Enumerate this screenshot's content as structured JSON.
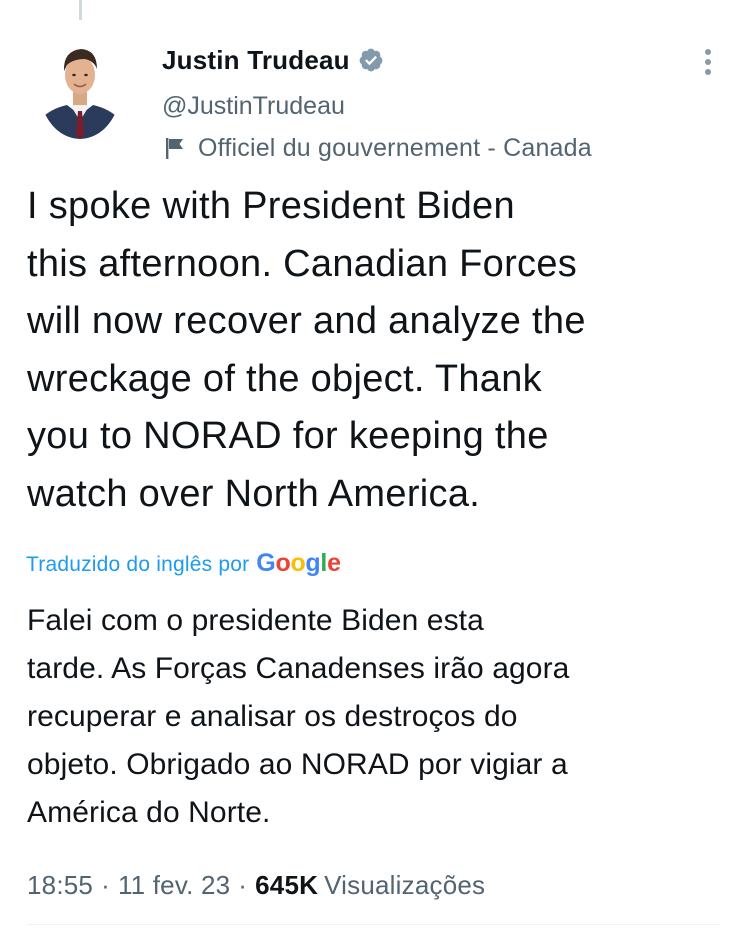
{
  "tweet": {
    "author": {
      "display_name": "Justin Trudeau",
      "handle": "@JustinTrudeau",
      "verified": true,
      "label": "Officiel du gouvernement - Canada"
    },
    "text_lines": [
      "I spoke with President Biden",
      "this afternoon. Canadian Forces",
      "will now recover and analyze the",
      "wreckage of the object. Thank",
      "you to NORAD for keeping the",
      "watch over North America."
    ],
    "translation": {
      "label": "Traduzido do inglês por",
      "provider": "Google",
      "text_lines": [
        "Falei com o presidente Biden esta",
        "tarde. As Forças Canadenses irão agora",
        "recuperar e analisar os destroços do",
        "objeto. Obrigado ao NORAD por vigiar a",
        "América do Norte."
      ]
    },
    "meta": {
      "time": "18:55",
      "separator": "·",
      "date": "11 fev. 23",
      "views_count": "645K",
      "views_label": "Visualizações"
    }
  },
  "icons": {
    "verified": "verified-badge-icon",
    "government_label": "flag-icon",
    "more": "more-vertical-icon"
  },
  "colors": {
    "text": "#0f1419",
    "secondary": "#536471",
    "link": "#1d9bf0",
    "verified_badge": "#829aab",
    "google_blue": "#4285f4",
    "google_red": "#ea4335",
    "google_yellow": "#fbbc05",
    "google_green": "#34a853"
  }
}
